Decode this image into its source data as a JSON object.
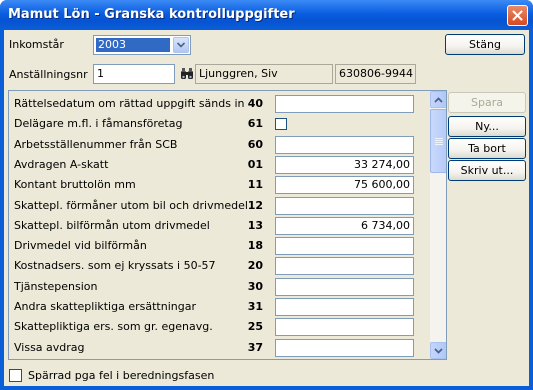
{
  "window": {
    "title": "Mamut Lön - Granska kontrolluppgifter",
    "accent": "#0a5fd8"
  },
  "header": {
    "income_year_label": "Inkomstår",
    "income_year_value": "2003",
    "close_button_label": "Stäng",
    "employment_no_label": "Anställningsnr",
    "employment_no_value": "1",
    "employee_name": "Ljunggren, Siv",
    "personal_id": "630806-9944"
  },
  "actions": {
    "save": "Spara",
    "new": "Ny...",
    "delete": "Ta bort",
    "print": "Skriv ut..."
  },
  "rows": [
    {
      "label": "Rättelsedatum om rättad uppgift sänds in",
      "code": "40",
      "value": "",
      "type": "text"
    },
    {
      "label": "Delägare m.fl. i fåmansföretag",
      "code": "61",
      "value": "",
      "type": "checkbox"
    },
    {
      "label": "Arbetsställenummer från SCB",
      "code": "60",
      "value": "",
      "type": "text"
    },
    {
      "label": "Avdragen A-skatt",
      "code": "01",
      "value": "33 274,00",
      "type": "text"
    },
    {
      "label": "Kontant bruttolön mm",
      "code": "11",
      "value": "75 600,00",
      "type": "text"
    },
    {
      "label": "Skattepl. förmåner utom bil och drivmedel",
      "code": "12",
      "value": "",
      "type": "text"
    },
    {
      "label": "Skattepl. bilförmån utom drivmedel",
      "code": "13",
      "value": "6 734,00",
      "type": "text"
    },
    {
      "label": "Drivmedel vid bilförmån",
      "code": "18",
      "value": "",
      "type": "text"
    },
    {
      "label": "Kostnadsers. som ej kryssats i 50-57",
      "code": "20",
      "value": "",
      "type": "text"
    },
    {
      "label": "Tjänstepension",
      "code": "30",
      "value": "",
      "type": "text"
    },
    {
      "label": "Andra skattepliktiga ersättningar",
      "code": "31",
      "value": "",
      "type": "text"
    },
    {
      "label": "Skattepliktiga ers. som gr. egenavg.",
      "code": "25",
      "value": "",
      "type": "text"
    },
    {
      "label": "Vissa avdrag",
      "code": "37",
      "value": "",
      "type": "text"
    }
  ],
  "footer": {
    "blocked_label": "Spärrad pga fel i beredningsfasen"
  }
}
